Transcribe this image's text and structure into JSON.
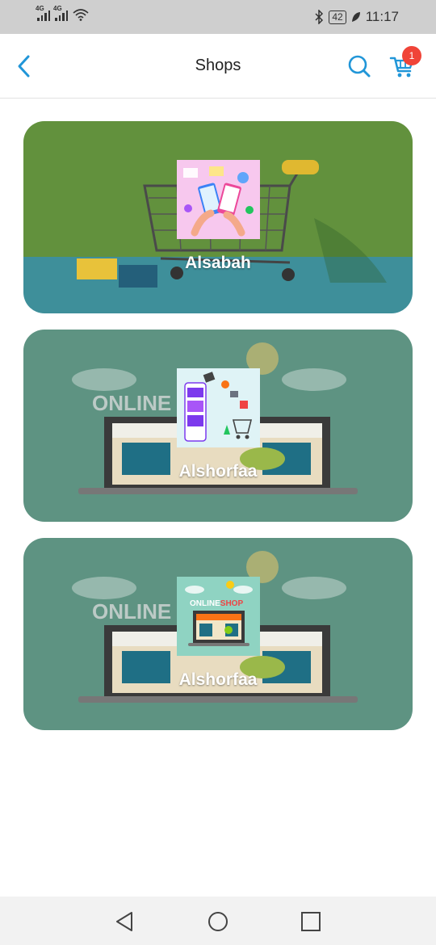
{
  "status": {
    "signal1": "4G",
    "signal2": "4G",
    "battery": "42",
    "time": "11:17",
    "icons": [
      "bluetooth-icon",
      "leaf-icon",
      "wifi-icon"
    ]
  },
  "header": {
    "title": "Shops",
    "cart_count": "1",
    "accent": "#2196d8",
    "badge_color": "#f04438"
  },
  "shops": [
    {
      "name": "Alsabah"
    },
    {
      "name": "Alshorfaa"
    },
    {
      "name": "Alshorfaa"
    }
  ],
  "thumb_texts": {
    "online": "ONLINE",
    "shop": "SHOP"
  },
  "nav": {
    "icons": [
      "back-triangle-icon",
      "home-circle-icon",
      "recents-square-icon"
    ]
  }
}
